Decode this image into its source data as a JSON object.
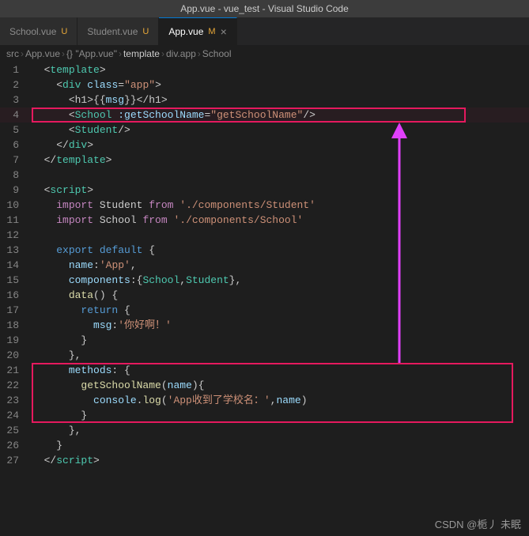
{
  "titlebar": {
    "text": "App.vue - vue_test - Visual Studio Code"
  },
  "tabs": [
    {
      "id": "school",
      "label": "School.vue",
      "modified": true,
      "modifier": "U",
      "active": false
    },
    {
      "id": "student",
      "label": "Student.vue",
      "modified": true,
      "modifier": "U",
      "active": false
    },
    {
      "id": "app",
      "label": "App.vue",
      "modified": true,
      "modifier": "M",
      "active": true
    }
  ],
  "breadcrumb": {
    "parts": [
      "src",
      ">",
      "App.vue",
      ">",
      "{} \"App.vue\"",
      ">",
      "template",
      ">",
      "div.app",
      ">",
      "School"
    ]
  },
  "lines": [
    {
      "num": 1,
      "tokens": [
        {
          "t": "  ",
          "c": "white"
        },
        {
          "t": "<",
          "c": "punct"
        },
        {
          "t": "template",
          "c": "cyan"
        },
        {
          "t": ">",
          "c": "punct"
        }
      ]
    },
    {
      "num": 2,
      "tokens": [
        {
          "t": "    ",
          "c": "white"
        },
        {
          "t": "<",
          "c": "punct"
        },
        {
          "t": "div",
          "c": "cyan"
        },
        {
          "t": " ",
          "c": "white"
        },
        {
          "t": "class",
          "c": "light-blue"
        },
        {
          "t": "=",
          "c": "white"
        },
        {
          "t": "\"app\"",
          "c": "orange"
        },
        {
          "t": ">",
          "c": "punct"
        }
      ]
    },
    {
      "num": 3,
      "tokens": [
        {
          "t": "      ",
          "c": "white"
        },
        {
          "t": "<h1>{{",
          "c": "punct"
        },
        {
          "t": "msg",
          "c": "msg"
        },
        {
          "t": "}}</h1>",
          "c": "punct"
        }
      ]
    },
    {
      "num": 4,
      "tokens": [
        {
          "t": "      ",
          "c": "white"
        },
        {
          "t": "<",
          "c": "punct"
        },
        {
          "t": "School",
          "c": "cyan"
        },
        {
          "t": " ",
          "c": "white"
        },
        {
          "t": ":getSchoolName",
          "c": "light-blue"
        },
        {
          "t": "=",
          "c": "white"
        },
        {
          "t": "\"getSchoolName\"",
          "c": "orange"
        },
        {
          "t": "/>",
          "c": "punct"
        }
      ],
      "highlight": true
    },
    {
      "num": 5,
      "tokens": [
        {
          "t": "      ",
          "c": "white"
        },
        {
          "t": "<",
          "c": "punct"
        },
        {
          "t": "Student",
          "c": "cyan"
        },
        {
          "t": "/>",
          "c": "punct"
        }
      ]
    },
    {
      "num": 6,
      "tokens": [
        {
          "t": "    ",
          "c": "white"
        },
        {
          "t": "</",
          "c": "punct"
        },
        {
          "t": "div",
          "c": "cyan"
        },
        {
          "t": ">",
          "c": "punct"
        }
      ]
    },
    {
      "num": 7,
      "tokens": [
        {
          "t": "  ",
          "c": "white"
        },
        {
          "t": "</",
          "c": "punct"
        },
        {
          "t": "template",
          "c": "cyan"
        },
        {
          "t": ">",
          "c": "punct"
        }
      ]
    },
    {
      "num": 8,
      "tokens": []
    },
    {
      "num": 9,
      "tokens": [
        {
          "t": "  ",
          "c": "white"
        },
        {
          "t": "<",
          "c": "punct"
        },
        {
          "t": "script",
          "c": "cyan"
        },
        {
          "t": ">",
          "c": "punct"
        }
      ]
    },
    {
      "num": 10,
      "tokens": [
        {
          "t": "    ",
          "c": "white"
        },
        {
          "t": "import",
          "c": "pink"
        },
        {
          "t": " Student ",
          "c": "white"
        },
        {
          "t": "from",
          "c": "pink"
        },
        {
          "t": " ",
          "c": "white"
        },
        {
          "t": "'./components/Student'",
          "c": "orange"
        }
      ]
    },
    {
      "num": 11,
      "tokens": [
        {
          "t": "    ",
          "c": "white"
        },
        {
          "t": "import",
          "c": "pink"
        },
        {
          "t": " School ",
          "c": "white"
        },
        {
          "t": "from",
          "c": "pink"
        },
        {
          "t": " ",
          "c": "white"
        },
        {
          "t": "'./components/School'",
          "c": "orange"
        }
      ]
    },
    {
      "num": 12,
      "tokens": []
    },
    {
      "num": 13,
      "tokens": [
        {
          "t": "    ",
          "c": "white"
        },
        {
          "t": "export",
          "c": "blue"
        },
        {
          "t": " ",
          "c": "white"
        },
        {
          "t": "default",
          "c": "blue"
        },
        {
          "t": " {",
          "c": "white"
        }
      ]
    },
    {
      "num": 14,
      "tokens": [
        {
          "t": "      ",
          "c": "white"
        },
        {
          "t": "name",
          "c": "light-blue"
        },
        {
          "t": ":",
          "c": "white"
        },
        {
          "t": "'App'",
          "c": "orange"
        },
        {
          "t": ",",
          "c": "white"
        }
      ]
    },
    {
      "num": 15,
      "tokens": [
        {
          "t": "      ",
          "c": "white"
        },
        {
          "t": "components",
          "c": "light-blue"
        },
        {
          "t": ":{",
          "c": "white"
        },
        {
          "t": "School",
          "c": "cyan"
        },
        {
          "t": ",",
          "c": "white"
        },
        {
          "t": "Student",
          "c": "cyan"
        },
        {
          "t": "},",
          "c": "white"
        }
      ]
    },
    {
      "num": 16,
      "tokens": [
        {
          "t": "      ",
          "c": "white"
        },
        {
          "t": "data",
          "c": "yellow"
        },
        {
          "t": "() {",
          "c": "white"
        }
      ]
    },
    {
      "num": 17,
      "tokens": [
        {
          "t": "        ",
          "c": "white"
        },
        {
          "t": "return",
          "c": "blue"
        },
        {
          "t": " {",
          "c": "white"
        }
      ]
    },
    {
      "num": 18,
      "tokens": [
        {
          "t": "          ",
          "c": "white"
        },
        {
          "t": "msg",
          "c": "light-blue"
        },
        {
          "t": ":",
          "c": "white"
        },
        {
          "t": "'你好啊！'",
          "c": "orange"
        }
      ]
    },
    {
      "num": 19,
      "tokens": [
        {
          "t": "        ",
          "c": "white"
        },
        {
          "t": "}",
          "c": "white"
        }
      ]
    },
    {
      "num": 20,
      "tokens": [
        {
          "t": "      ",
          "c": "white"
        },
        {
          "t": "},",
          "c": "white"
        }
      ]
    },
    {
      "num": 21,
      "tokens": [
        {
          "t": "      ",
          "c": "white"
        },
        {
          "t": "methods",
          "c": "light-blue"
        },
        {
          "t": ": {",
          "c": "white"
        }
      ],
      "methodsStart": true
    },
    {
      "num": 22,
      "tokens": [
        {
          "t": "        ",
          "c": "white"
        },
        {
          "t": "getSchoolName",
          "c": "yellow"
        },
        {
          "t": "(",
          "c": "white"
        },
        {
          "t": "name",
          "c": "light-blue"
        },
        {
          "t": "){",
          "c": "white"
        }
      ]
    },
    {
      "num": 23,
      "tokens": [
        {
          "t": "          ",
          "c": "white"
        },
        {
          "t": "console",
          "c": "light-blue"
        },
        {
          "t": ".",
          "c": "white"
        },
        {
          "t": "log",
          "c": "yellow"
        },
        {
          "t": "(",
          "c": "white"
        },
        {
          "t": "'App收到了学校名：'",
          "c": "orange"
        },
        {
          "t": ",",
          "c": "white"
        },
        {
          "t": "name",
          "c": "light-blue"
        },
        {
          "t": ")",
          "c": "white"
        }
      ]
    },
    {
      "num": 24,
      "tokens": [
        {
          "t": "        ",
          "c": "white"
        },
        {
          "t": "}",
          "c": "white"
        }
      ],
      "methodsEnd": true
    },
    {
      "num": 25,
      "tokens": [
        {
          "t": "      ",
          "c": "white"
        },
        {
          "t": "},",
          "c": "white"
        }
      ]
    },
    {
      "num": 26,
      "tokens": [
        {
          "t": "    ",
          "c": "white"
        },
        {
          "t": "}",
          "c": "white"
        }
      ]
    },
    {
      "num": 27,
      "tokens": [
        {
          "t": "  ",
          "c": "white"
        },
        {
          "t": "</",
          "c": "punct"
        },
        {
          "t": "script",
          "c": "cyan"
        },
        {
          "t": ">",
          "c": "punct"
        }
      ]
    }
  ],
  "watermark": "CSDN @栀丿 未眠"
}
